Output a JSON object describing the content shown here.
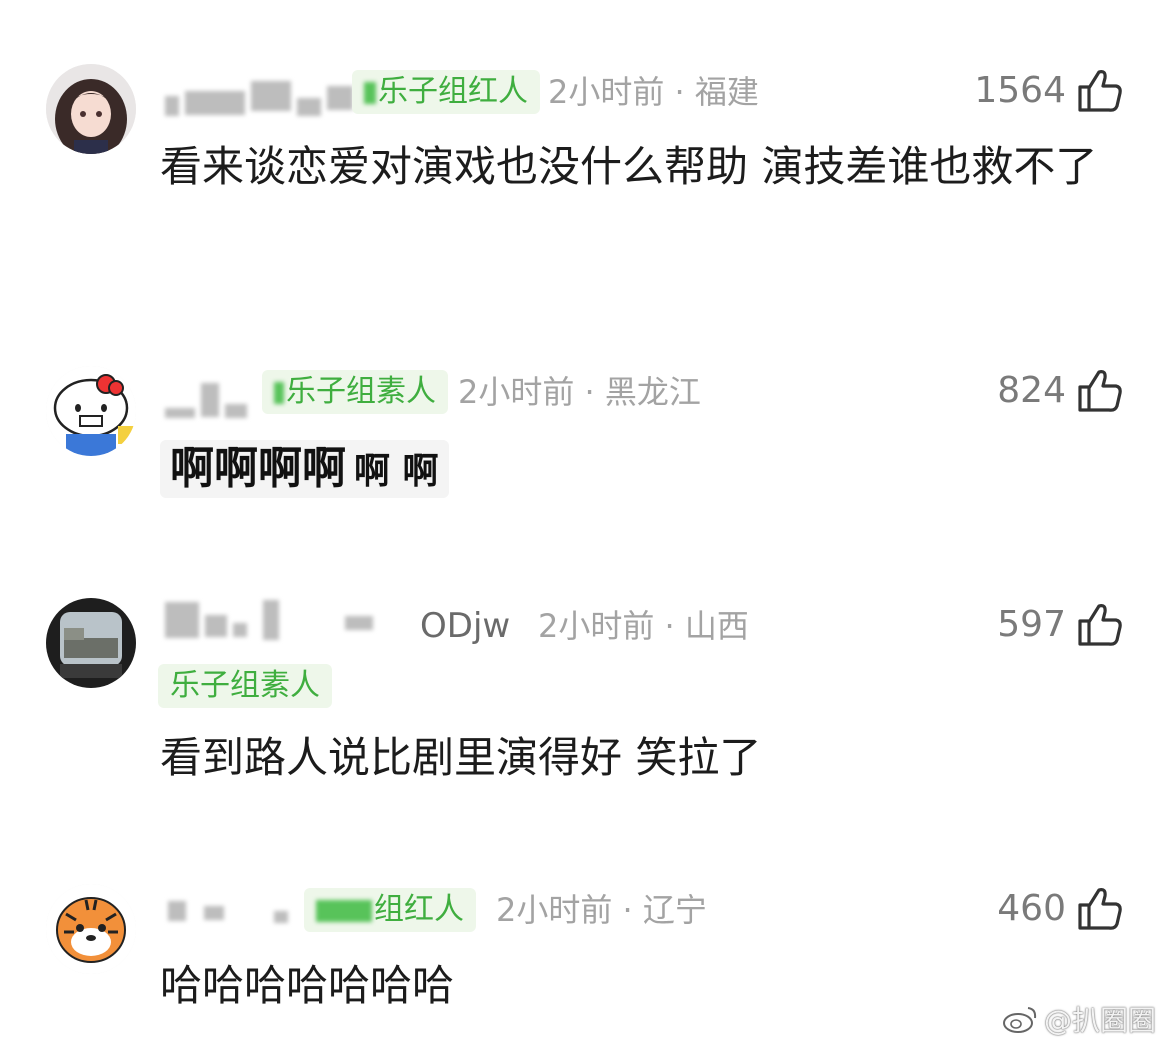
{
  "comments": [
    {
      "badge": "乐子组红人",
      "meta": "2小时前 · 福建",
      "likes": "1564",
      "body": "看来谈恋爱对演戏也没什么帮助 演技差谁也救不了"
    },
    {
      "badge": "乐子组素人",
      "meta": "2小时前 · 黑龙江",
      "likes": "824",
      "body_big": "啊啊啊啊",
      "body_small": "啊 啊"
    },
    {
      "name_tail": "ODjw",
      "meta": "2小时前 · 山西",
      "likes": "597",
      "badge": "乐子组素人",
      "body": "看到路人说比剧里演得好 笑拉了"
    },
    {
      "badge": "组红人",
      "meta": "2小时前 · 辽宁",
      "likes": "460",
      "body": "哈哈哈哈哈哈哈"
    }
  ],
  "watermark": "@扒圈圈",
  "colors": {
    "badge_bg": "#eef7ea",
    "badge_text": "#3fae3f",
    "meta": "#a3a3a3"
  },
  "icons": [
    "thumbs-up-icon",
    "weibo-logo-icon"
  ]
}
